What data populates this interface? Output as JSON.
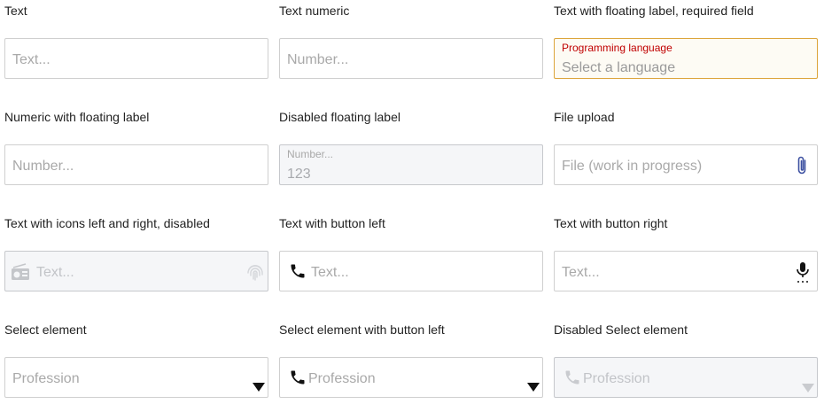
{
  "rows": [
    {
      "fields": [
        {
          "label": "Text",
          "placeholder": "Text..."
        },
        {
          "label": "Text numeric",
          "placeholder": "Number..."
        },
        {
          "label": "Text with floating label, required field",
          "floating_label": "Programming language",
          "placeholder": "Select a language"
        }
      ]
    },
    {
      "fields": [
        {
          "label": "Numeric with floating label",
          "placeholder": "Number..."
        },
        {
          "label": "Disabled floating label",
          "floating_label": "Number...",
          "value": "123"
        },
        {
          "label": "File upload",
          "placeholder": "File (work in progress)",
          "icon": "paperclip-icon"
        }
      ]
    },
    {
      "fields": [
        {
          "label": "Text with icons left and right, disabled",
          "placeholder": "Text...",
          "icon_left": "radio-icon",
          "icon_right": "fingerprint-icon"
        },
        {
          "label": "Text with button left",
          "placeholder": "Text...",
          "icon_left": "phone-icon"
        },
        {
          "label": "Text with button right",
          "placeholder": "Text...",
          "icon_right": "microphone-icon"
        }
      ]
    },
    {
      "fields": [
        {
          "label": "Select element",
          "selected": "Profession",
          "icon_right": "caret-down-icon"
        },
        {
          "label": "Select element with button left",
          "selected": "Profession",
          "icon_left": "phone-icon",
          "icon_right": "caret-down-icon"
        },
        {
          "label": "Disabled Select element",
          "selected": "Profession",
          "icon_left": "phone-icon",
          "icon_right": "caret-down-icon"
        }
      ]
    }
  ],
  "colors": {
    "required_border": "#dca43a",
    "required_label": "#c00000",
    "disabled_background": "#f5f6f8",
    "paperclip": "#3b4fa0"
  }
}
